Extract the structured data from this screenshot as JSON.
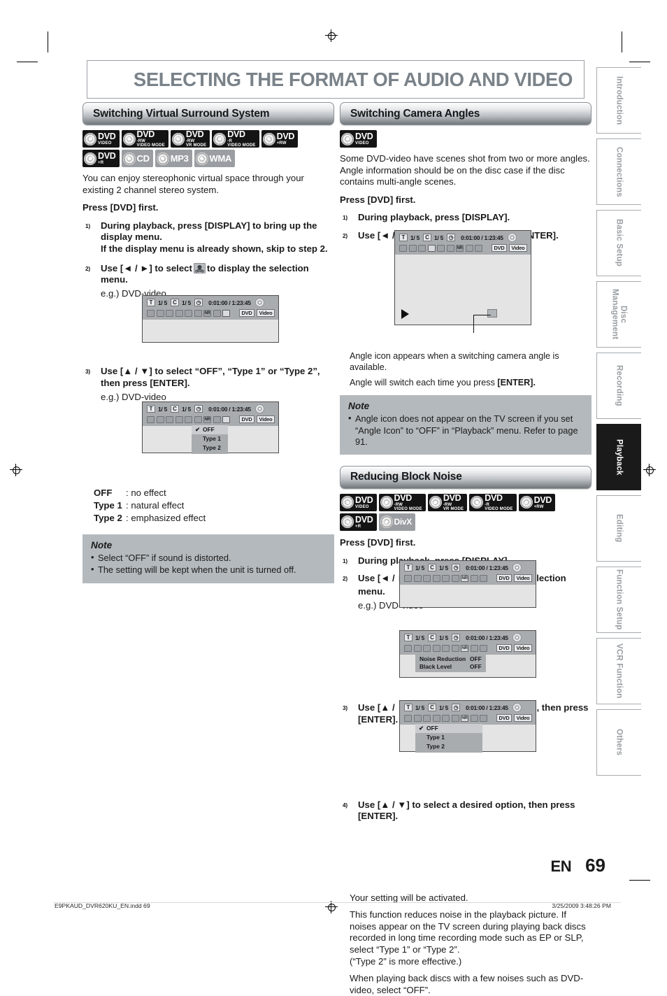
{
  "page": {
    "title": "SELECTING THE FORMAT OF AUDIO AND VIDEO",
    "lang_code": "EN",
    "page_number": "69",
    "footer_left": "E9PKAUD_DVR620KU_EN.indd   69",
    "footer_right": "3/25/2009   3:48:26 PM"
  },
  "side_tabs": [
    {
      "label": "Introduction",
      "active": false
    },
    {
      "label": "Connections",
      "active": false
    },
    {
      "label": "Basic Setup",
      "active": false
    },
    {
      "label": "Disc\nManagement",
      "active": false
    },
    {
      "label": "Recording",
      "active": false
    },
    {
      "label": "Playback",
      "active": true
    },
    {
      "label": "Editing",
      "active": false
    },
    {
      "label": "Function Setup",
      "active": false
    },
    {
      "label": "VCR Function",
      "active": false
    },
    {
      "label": "Others",
      "active": false
    }
  ],
  "sections": {
    "surround": {
      "heading": "Switching Virtual Surround System",
      "logos": [
        {
          "t1": "DVD",
          "t2": "VIDEO",
          "t3": "",
          "style": "black"
        },
        {
          "t1": "DVD",
          "t2": "-RW",
          "t3": "VIDEO MODE",
          "style": "black"
        },
        {
          "t1": "DVD",
          "t2": "-RW",
          "t3": "VR MODE",
          "style": "black"
        },
        {
          "t1": "DVD",
          "t2": "-R",
          "t3": "VIDEO MODE",
          "style": "black"
        },
        {
          "t1": "DVD",
          "t2": "+RW",
          "t3": "",
          "style": "black"
        },
        {
          "t1": "DVD",
          "t2": "+R",
          "t3": "",
          "style": "black"
        },
        {
          "t1": "CD",
          "t2": "",
          "t3": "",
          "style": "grey"
        },
        {
          "t1": "MP3",
          "t2": "",
          "t3": "",
          "style": "grey"
        },
        {
          "t1": "WMA",
          "t2": "",
          "t3": "",
          "style": "grey"
        }
      ],
      "intro": "You can enjoy stereophonic virtual space through your existing 2 channel stereo system.",
      "press_first": "Press [DVD] first.",
      "step1_num": "1)",
      "step1_line1": "During playback, press [DISPLAY] to bring up the display menu.",
      "step1_line2": "If the display menu is already shown, skip to step 2.",
      "step2_num": "2)",
      "step2_a": "Use [◄ / ►] to select",
      "step2_b": "to display the selection menu.",
      "step2_eg": "e.g.) DVD-video",
      "step3_num": "3)",
      "step3_text": "Use [▲ / ▼] to select “OFF”, “Type 1” or “Type 2”, then press [ENTER].",
      "step3_eg": "e.g.) DVD-video",
      "legend": [
        {
          "key": "OFF",
          "val": ": no effect"
        },
        {
          "key": "Type 1",
          "val": ": natural effect"
        },
        {
          "key": "Type 2",
          "val": ": emphasized effect"
        }
      ],
      "note_title": "Note",
      "note_items": [
        "Select “OFF” if sound is distorted.",
        "The setting will be kept when the unit is turned off."
      ]
    },
    "camera": {
      "heading": "Switching Camera Angles",
      "logos": [
        {
          "t1": "DVD",
          "t2": "VIDEO",
          "t3": "",
          "style": "black"
        }
      ],
      "intro": "Some DVD-video have scenes shot from two or more angles. Angle information should be on the disc case if the disc contains multi-angle scenes.",
      "press_first": "Press [DVD] first.",
      "step1_num": "1)",
      "step1_text": "During playback, press [DISPLAY].",
      "step2_num": "2)",
      "step2_a": "Use [◄ / ►] to select",
      "step2_b": ", then press [ENTER].",
      "caption1": "Angle icon appears when a switching camera angle is available.",
      "caption2_a": "Angle will switch each time you press",
      "caption2_b": "[ENTER].",
      "note_title": "Note",
      "note_items": [
        "Angle icon does not appear on the TV screen if you set “Angle Icon” to “OFF” in “Playback” menu. Refer to page 91."
      ]
    },
    "blocknoise": {
      "heading": "Reducing Block Noise",
      "logos": [
        {
          "t1": "DVD",
          "t2": "VIDEO",
          "t3": "",
          "style": "black"
        },
        {
          "t1": "DVD",
          "t2": "-RW",
          "t3": "VIDEO MODE",
          "style": "black"
        },
        {
          "t1": "DVD",
          "t2": "-RW",
          "t3": "VR MODE",
          "style": "black"
        },
        {
          "t1": "DVD",
          "t2": "-R",
          "t3": "VIDEO MODE",
          "style": "black"
        },
        {
          "t1": "DVD",
          "t2": "+RW",
          "t3": "",
          "style": "black"
        },
        {
          "t1": "DVD",
          "t2": "+R",
          "t3": "",
          "style": "black"
        },
        {
          "t1": "DivX",
          "t2": "",
          "t3": "",
          "style": "grey"
        }
      ],
      "press_first": "Press [DVD] first.",
      "step1_num": "1)",
      "step1_text": "During playback, press [DISPLAY].",
      "step2_num": "2)",
      "step2_a": "Use [◄ / ►] to select",
      "step2_b": "to display the selection menu.",
      "step2_eg": "e.g.) DVD-video",
      "step3_num": "3)",
      "step3_text": "Use [▲ / ▼] to, select “Noise Reduction”, then press [ENTER].",
      "step4_num": "4)",
      "step4_text": "Use [▲ / ▼] to select a desired option, then press [ENTER].",
      "after1": "Your setting will be activated.",
      "after2": "This function reduces noise in the playback picture. If noises appear on the TV screen during playing back discs recorded in long time recording mode such as EP or SLP, select “Type 1” or “Type 2”.",
      "after3": "(“Type 2” is more effective.)",
      "after4": "When playing back discs with a few noises such as DVD-video, select “OFF”."
    }
  },
  "osd": {
    "title_chip": "T",
    "title_value": "1/ 5",
    "chapter_chip": "C",
    "chapter_value": "1/ 5",
    "time_value": "0:01:00 / 1:23:45",
    "badge_disc": "DVD",
    "badge_format": "Video",
    "dropdown": [
      {
        "label": "OFF",
        "checked": true
      },
      {
        "label": "Type 1",
        "checked": false
      },
      {
        "label": "Type 2",
        "checked": false
      }
    ],
    "nr_table": [
      {
        "key": "Noise Reduction",
        "value": "OFF"
      },
      {
        "key": "Black Level",
        "value": "OFF"
      }
    ]
  }
}
